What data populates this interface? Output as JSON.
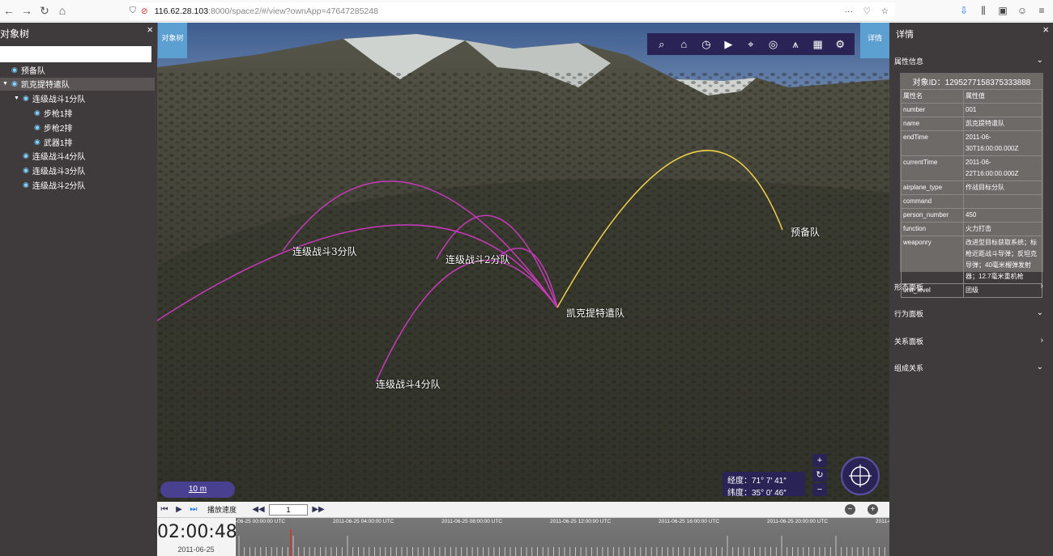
{
  "browser": {
    "url_host": "116.62.28.103",
    "url_rest": ":8000/space2/#/view?ownApp=47647285248",
    "menu": "···"
  },
  "left_panel": {
    "title": "对象树",
    "close": "×",
    "tree": [
      {
        "label": "预备队",
        "level": 0,
        "caret": ""
      },
      {
        "label": "凯克提特遣队",
        "level": 0,
        "caret": "▼",
        "selected": true
      },
      {
        "label": "连级战斗1分队",
        "level": 1,
        "caret": "▼"
      },
      {
        "label": "步枪1排",
        "level": 2,
        "caret": ""
      },
      {
        "label": "步枪2排",
        "level": 2,
        "caret": ""
      },
      {
        "label": "武器1排",
        "level": 2,
        "caret": ""
      },
      {
        "label": "连级战斗4分队",
        "level": 1,
        "caret": ""
      },
      {
        "label": "连级战斗3分队",
        "level": 1,
        "caret": ""
      },
      {
        "label": "连级战斗2分队",
        "level": 1,
        "caret": ""
      }
    ]
  },
  "map": {
    "tab_left": "对象树",
    "tab_right": "详情",
    "toolbar": [
      "search-icon",
      "home-icon",
      "clock-icon",
      "video-icon",
      "crosshair-icon",
      "eye-frame-icon",
      "tower-icon",
      "grid-icon",
      "gear-icon"
    ],
    "units": {
      "u3": "连级战斗3分队",
      "u2": "连级战斗2分队",
      "u4": "连级战斗4分队",
      "hq": "凯克提特遣队",
      "reserve": "预备队"
    },
    "scale": "10 m",
    "longitude": "经度：71° 7′ 41″",
    "latitude": "纬度：35° 0′ 46″",
    "zoom_in": "+",
    "reset": "↻",
    "zoom_out": "−",
    "colors": {
      "attack_arc": "#c43ab8",
      "reserve_arc": "#f0d04a"
    }
  },
  "playback": {
    "speed_label": "播放速度",
    "speed_value": "1",
    "time": "02:00:48",
    "date": "2011-06-25",
    "ticks": [
      "2011-06-25 00:00:00 UTC",
      "2011-06-25 04:00:00 UTC",
      "2011-06-25 08:00:00 UTC",
      "2011-06-25 12:00:00 UTC",
      "2011-06-25 16:00:00 UTC",
      "2011-06-25 20:00:00 UTC",
      "2011-06-26"
    ]
  },
  "right_panel": {
    "title": "详情",
    "close": "×",
    "attr_section": "属性信息",
    "object_id": "对象ID：1295277158375333888",
    "table_header": [
      "属性名",
      "属性值"
    ],
    "rows": [
      [
        "number",
        "001"
      ],
      [
        "name",
        "凯克提特遣队"
      ],
      [
        "endTime",
        "2011-06-30T16:00:00.000Z"
      ],
      [
        "currentTime",
        "2011-06-22T16:00:00.000Z"
      ],
      [
        "airplane_type",
        "作战目标分队"
      ],
      [
        "command",
        ""
      ],
      [
        "person_number",
        "450"
      ],
      [
        "function",
        "火力打击"
      ],
      [
        "weaponry",
        "改进型目标获取系统；标枪近距战斗导弹；反坦克导弹；40毫米榴弹发射器；12.7毫米重机枪"
      ],
      [
        "unit_level",
        "团级"
      ]
    ],
    "sections": [
      {
        "label": "形态面板",
        "chevron": "›"
      },
      {
        "label": "行为面板",
        "chevron": "⌄"
      },
      {
        "label": "关系面板",
        "chevron": "›"
      },
      {
        "label": "组成关系",
        "chevron": "⌄"
      }
    ]
  }
}
